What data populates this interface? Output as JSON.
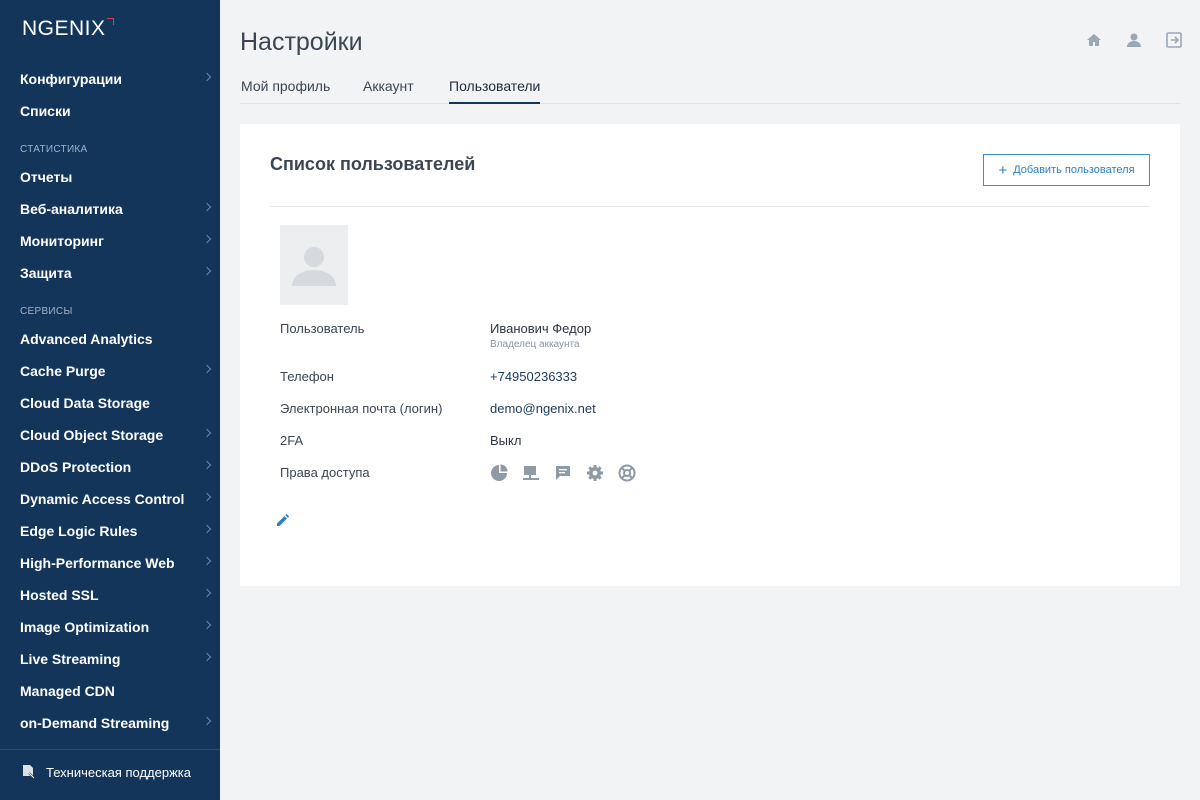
{
  "brand": {
    "logo_text": "NGENIX"
  },
  "sidebar": {
    "items_top": [
      {
        "label": "Конфигурации",
        "chevron": true
      },
      {
        "label": "Списки",
        "chevron": false
      }
    ],
    "section_stats": "СТАТИСТИКА",
    "items_stats": [
      {
        "label": "Отчеты",
        "chevron": false
      },
      {
        "label": "Веб-аналитика",
        "chevron": true
      },
      {
        "label": "Мониторинг",
        "chevron": true
      },
      {
        "label": "Защита",
        "chevron": true
      }
    ],
    "section_services": "СЕРВИСЫ",
    "items_services": [
      {
        "label": "Advanced Analytics",
        "chevron": false
      },
      {
        "label": "Cache Purge",
        "chevron": true
      },
      {
        "label": "Cloud Data Storage",
        "chevron": false
      },
      {
        "label": "Cloud Object Storage",
        "chevron": true
      },
      {
        "label": "DDoS Protection",
        "chevron": true
      },
      {
        "label": "Dynamic Access Control",
        "chevron": true
      },
      {
        "label": "Edge Logic Rules",
        "chevron": true
      },
      {
        "label": "High-Performance Web",
        "chevron": true
      },
      {
        "label": "Hosted SSL",
        "chevron": true
      },
      {
        "label": "Image Optimization",
        "chevron": true
      },
      {
        "label": "Live Streaming",
        "chevron": true
      },
      {
        "label": "Managed CDN",
        "chevron": false
      },
      {
        "label": "on-Demand Streaming",
        "chevron": true
      }
    ],
    "support_label": "Техническая поддержка"
  },
  "header": {
    "title": "Настройки",
    "icons": [
      "home-icon",
      "user-icon",
      "logout-icon"
    ]
  },
  "tabs": [
    {
      "label": "Мой профиль",
      "active": false
    },
    {
      "label": "Аккаунт",
      "active": false
    },
    {
      "label": "Пользователи",
      "active": true
    }
  ],
  "card": {
    "title": "Список пользователей",
    "add_button_label": "Добавить пользователя",
    "user": {
      "name_label": "Пользователь",
      "name": "Иванович Федор",
      "role": "Владелец аккаунта",
      "phone_label": "Телефон",
      "phone": "+74950236333",
      "email_label": "Электронная почта (логин)",
      "email": "demo@ngenix.net",
      "twofa_label": "2FA",
      "twofa": "Выкл",
      "access_label": "Права доступа",
      "access_icons": [
        "statistics-icon",
        "services-icon",
        "messages-icon",
        "settings-icon",
        "support-icon"
      ]
    }
  },
  "colors": {
    "sidebar_bg": "#13355a",
    "accent": "#2a7fc6",
    "background": "#f2f3f4"
  }
}
